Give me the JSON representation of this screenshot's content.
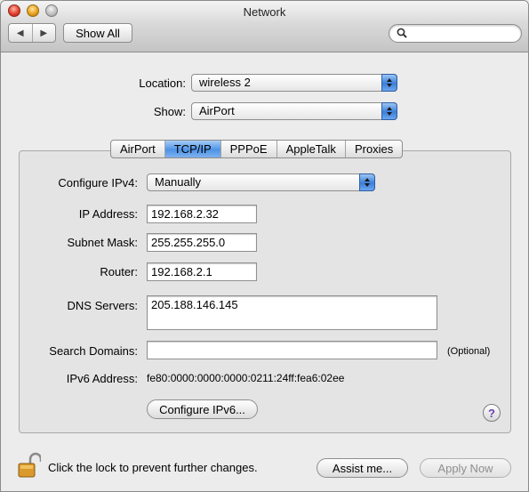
{
  "window": {
    "title": "Network"
  },
  "toolbar": {
    "back_icon": "◀",
    "forward_icon": "▶",
    "show_all_label": "Show All",
    "search_placeholder": ""
  },
  "location": {
    "label": "Location:",
    "value": "wireless 2"
  },
  "show": {
    "label": "Show:",
    "value": "AirPort"
  },
  "tabs": [
    {
      "label": "AirPort",
      "active": false
    },
    {
      "label": "TCP/IP",
      "active": true
    },
    {
      "label": "PPPoE",
      "active": false
    },
    {
      "label": "AppleTalk",
      "active": false
    },
    {
      "label": "Proxies",
      "active": false
    }
  ],
  "tcpip": {
    "configure_label": "Configure IPv4:",
    "configure_value": "Manually",
    "ip_label": "IP Address:",
    "ip_value": "192.168.2.32",
    "subnet_label": "Subnet Mask:",
    "subnet_value": "255.255.255.0",
    "router_label": "Router:",
    "router_value": "192.168.2.1",
    "dns_label": "DNS Servers:",
    "dns_value": "205.188.146.145",
    "search_label": "Search Domains:",
    "search_value": "",
    "optional_label": "(Optional)",
    "ipv6_label": "IPv6 Address:",
    "ipv6_value": "fe80:0000:0000:0000:0211:24ff:fea6:02ee",
    "configure_ipv6_label": "Configure IPv6...",
    "help_label": "?"
  },
  "footer": {
    "lock_text": "Click the lock to prevent further changes.",
    "assist_label": "Assist me...",
    "apply_label": "Apply Now"
  },
  "colors": {
    "accent": "#4d93e6",
    "help": "#6a3fb0",
    "disabled_text": "#8f8f8f"
  }
}
